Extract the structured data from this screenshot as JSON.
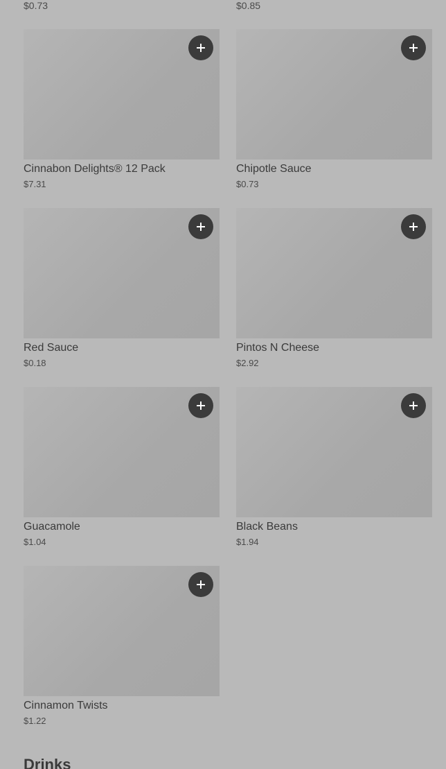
{
  "top_prices": {
    "left": "$0.73",
    "right": "$0.85"
  },
  "items": [
    {
      "name": "Cinnabon Delights® 12 Pack",
      "price": "$7.31",
      "icon": "plus-icon"
    },
    {
      "name": "Chipotle Sauce",
      "price": "$0.73",
      "icon": "plus-icon"
    },
    {
      "name": "Red Sauce",
      "price": "$0.18",
      "icon": "plus-icon"
    },
    {
      "name": "Pintos N Cheese",
      "price": "$2.92",
      "icon": "plus-icon"
    },
    {
      "name": "Guacamole",
      "price": "$1.04",
      "icon": "plus-icon"
    },
    {
      "name": "Black Beans",
      "price": "$1.94",
      "icon": "plus-icon"
    },
    {
      "name": "Cinnamon Twists",
      "price": "$1.22",
      "icon": "plus-icon"
    }
  ],
  "next_section": {
    "title": "Drinks"
  },
  "colors": {
    "background": "#b9b9b9",
    "image_placeholder": "#aaaaaa",
    "add_button": "#3b3b3b",
    "text": "#3a3a3a"
  }
}
